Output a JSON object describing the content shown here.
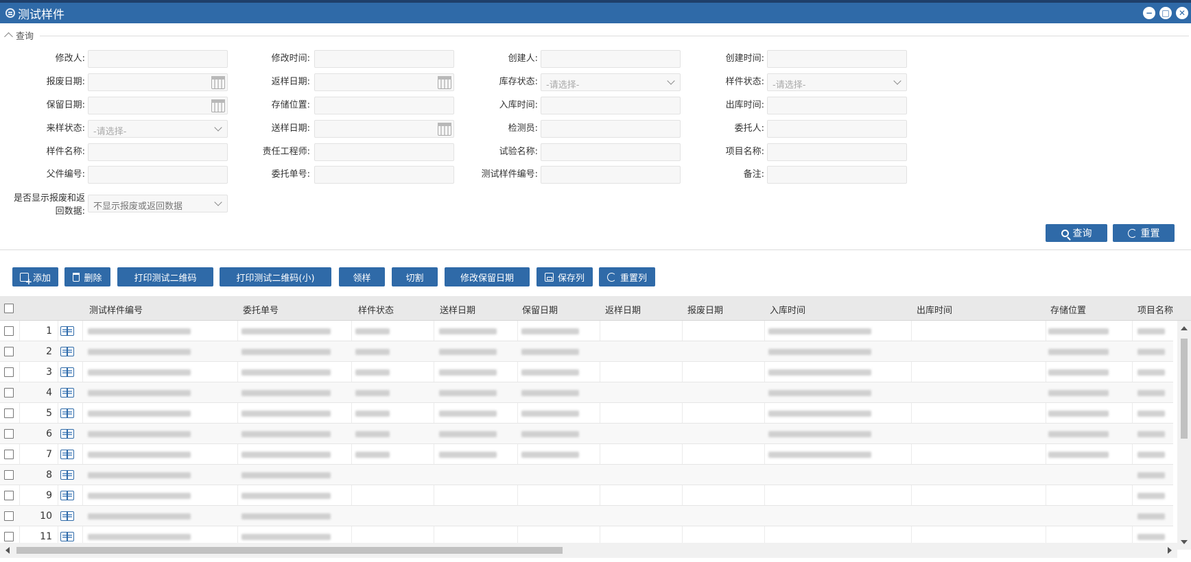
{
  "window": {
    "title": "测试样件"
  },
  "query": {
    "legend": "查询",
    "placeholder_select": "-请选择-",
    "fields": {
      "modifier": "修改人:",
      "modify_time": "修改时间:",
      "creator": "创建人:",
      "create_time": "创建时间:",
      "scrap_date": "报废日期:",
      "return_date": "返样日期:",
      "stock_status": "库存状态:",
      "sample_status": "样件状态:",
      "retain_date": "保留日期:",
      "storage_location": "存储位置:",
      "in_time": "入库时间:",
      "out_time": "出库时间:",
      "incoming_status": "来样状态:",
      "send_date": "送样日期:",
      "inspector": "检测员:",
      "client": "委托人:",
      "sample_name": "样件名称:",
      "engineer": "责任工程师:",
      "test_name": "试验名称:",
      "project_name": "项目名称:",
      "parent_no": "父件编号:",
      "order_no": "委托单号:",
      "test_sample_no": "测试样件编号:",
      "remark": "备注:",
      "show_scrap_line1": "是否显示报废和返",
      "show_scrap_line2": "回数据:"
    },
    "show_scrap_value": "不显示报废或返回数据",
    "search_button": "查询",
    "reset_button": "重置"
  },
  "toolbar": {
    "add": "添加",
    "delete": "删除",
    "print_qr": "打印测试二维码",
    "print_qr_small": "打印测试二维码(小)",
    "receive": "领样",
    "cut": "切割",
    "modify_retain_date": "修改保留日期",
    "save_columns": "保存列",
    "reset_columns": "重置列"
  },
  "grid": {
    "columns": [
      "测试样件编号",
      "委托单号",
      "样件状态",
      "送样日期",
      "保留日期",
      "返样日期",
      "报废日期",
      "入库时间",
      "出库时间",
      "存储位置",
      "项目名称"
    ],
    "rows": [
      "1",
      "2",
      "3",
      "4",
      "5",
      "6",
      "7",
      "8",
      "9",
      "10",
      "11"
    ]
  }
}
